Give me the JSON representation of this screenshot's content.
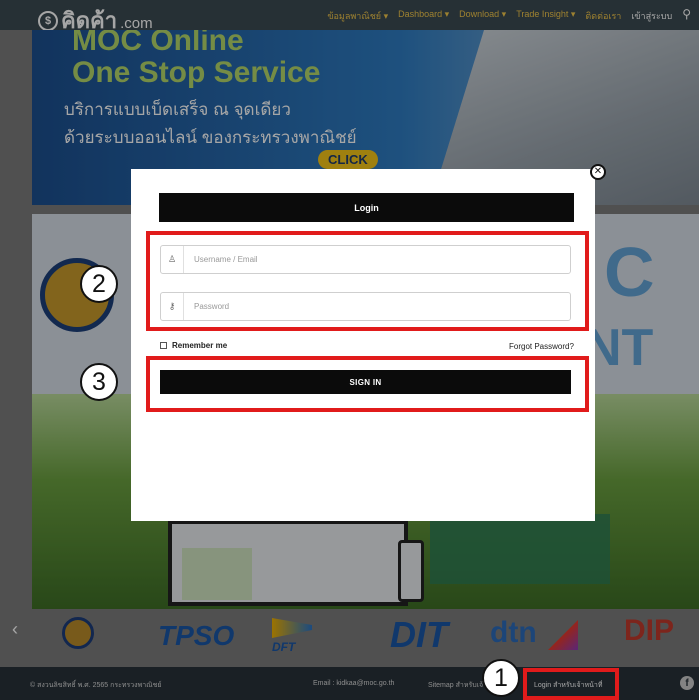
{
  "header": {
    "logo_text": "คิดค้า",
    "logo_suffix": ".com",
    "nav_items": [
      "ข้อมูลพาณิชย์ ▾",
      "Dashboard ▾",
      "Download ▾",
      "Trade Insight ▾",
      "ติดต่อเรา"
    ],
    "login_link": "เข้าสู่ระบบ"
  },
  "banner": {
    "line1": "MOC Online",
    "line2": "One Stop Service",
    "line3": "บริการแบบเบ็ดเสร็จ ณ จุดเดียว",
    "line4": "ด้วยระบบออนไลน์ ของกระทรวงพาณิชย์",
    "click": "CLICK"
  },
  "partners": {
    "tpso": "TPSO",
    "dft": "DFT",
    "dit": "DIT",
    "dtn": "dtn",
    "dip": "DIP"
  },
  "footer": {
    "copyright": "© สงวนลิขสิทธิ์ พ.ศ. 2565 กระทรวงพาณิชย์",
    "email": "Email : kidkaa@moc.go.th",
    "sitemap": "Sitemap สำหรับเจ้าหน้าที่",
    "login": "Login สำหรับเจ้าหน้าที่"
  },
  "modal": {
    "title": "Login",
    "username_placeholder": "Username / Email",
    "password_placeholder": "Password",
    "remember": "Remember me",
    "forgot": "Forgot Password?",
    "submit": "SIGN IN",
    "close": "✕"
  },
  "annotations": {
    "marker1": "1",
    "marker2": "2",
    "marker3": "3",
    "color": "#e11b1b"
  }
}
